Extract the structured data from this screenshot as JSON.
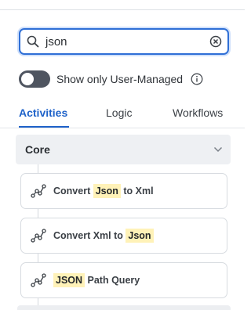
{
  "search": {
    "value": "json",
    "placeholder": ""
  },
  "toggle": {
    "label": "Show only User-Managed",
    "on": false
  },
  "tabs": [
    {
      "label": "Activities",
      "active": true
    },
    {
      "label": "Logic",
      "active": false
    },
    {
      "label": "Workflows",
      "active": false
    }
  ],
  "section": {
    "title": "Core"
  },
  "items": [
    {
      "prefix": "Convert ",
      "match": "Json",
      "suffix": " to Xml"
    },
    {
      "prefix": "Convert Xml to ",
      "match": "Json",
      "suffix": ""
    },
    {
      "prefix": "",
      "match": "JSON",
      "suffix": " Path Query"
    }
  ],
  "colors": {
    "accent": "#1e62c9",
    "highlight": "#fff2b8",
    "toggle_off": "#4f5560"
  },
  "icons": {
    "search": "search-icon",
    "clear": "clear-icon",
    "info": "info-icon",
    "activity": "activity-node-icon",
    "chevron": "chevron-down-icon"
  }
}
